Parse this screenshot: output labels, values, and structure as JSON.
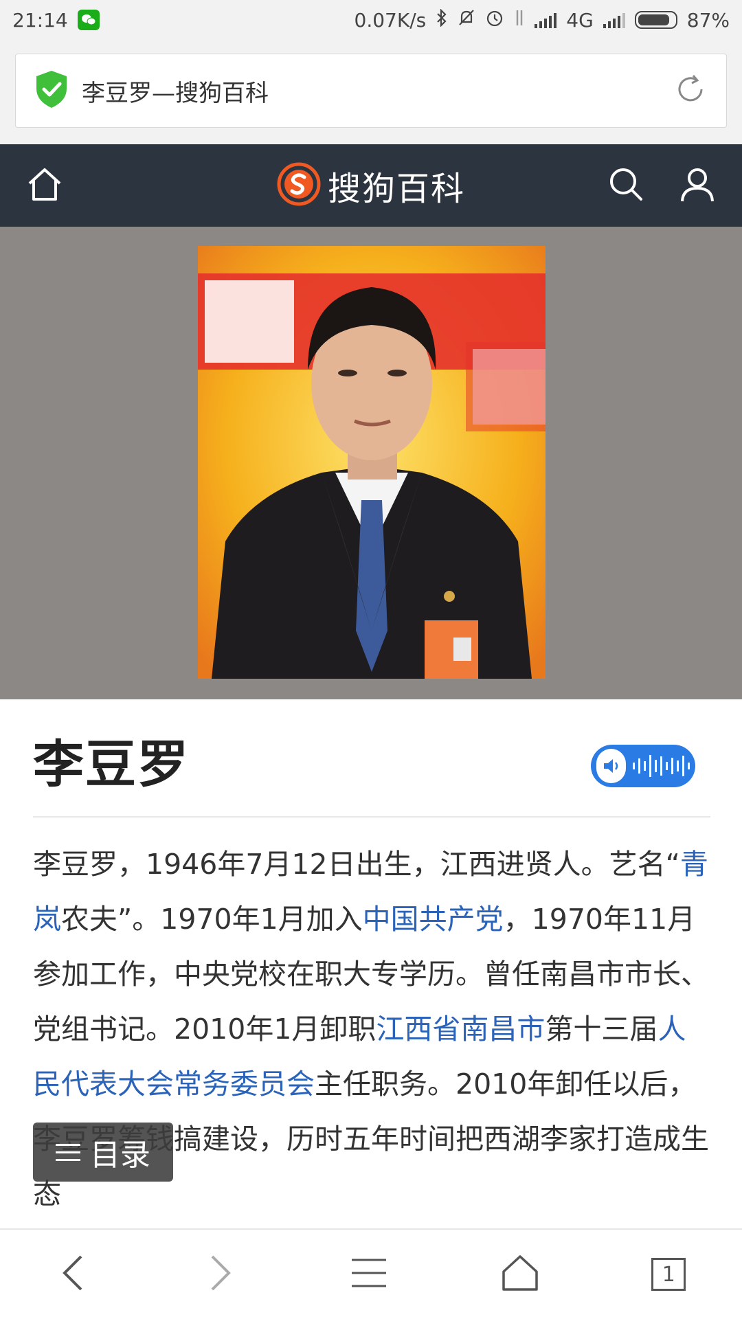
{
  "status": {
    "time": "21:14",
    "speed": "0.07K/s",
    "network": "4G",
    "battery": "87%",
    "battery_fraction": 0.87
  },
  "browser": {
    "url_title": "李豆罗—搜狗百科",
    "tab_count": "1"
  },
  "site": {
    "brand_name": "搜狗百科",
    "brand_color": "#f05a22",
    "header_bg": "#2c3440"
  },
  "entry": {
    "title": "李豆罗",
    "paragraph": [
      {
        "text": "李豆罗，1946年7月12日出生，江西进贤人。艺名“",
        "link": false
      },
      {
        "text": "青岚",
        "link": true
      },
      {
        "text": "农夫”。1970年1月加入",
        "link": false
      },
      {
        "text": "中国共产党",
        "link": true
      },
      {
        "text": "，1970年11月参加工作，中央党校在职大专学历。曾任南昌市市长、党组书记。2010年1月卸职",
        "link": false
      },
      {
        "text": "江西省南昌市",
        "link": true
      },
      {
        "text": "第十三届",
        "link": false
      },
      {
        "text": "人民代表大会常务委员会",
        "link": true
      },
      {
        "text": "主任职务。2010年卸任以后，李豆罗筹钱搞建设，历时五年时间把西湖李家打造成生态",
        "link": false
      }
    ]
  },
  "toc": {
    "label": "目录"
  },
  "link_color": "#2a63b8"
}
